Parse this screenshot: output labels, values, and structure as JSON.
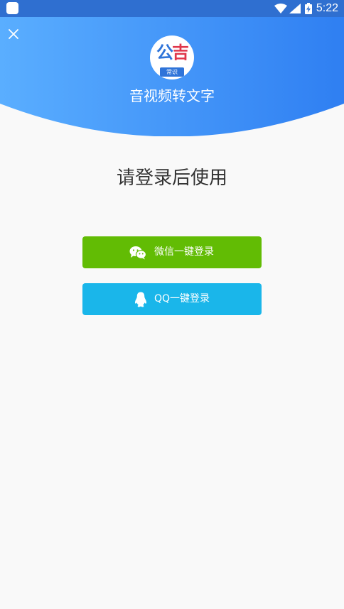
{
  "status_bar": {
    "time": "5:22",
    "icons": [
      "app-notification-icon",
      "wifi-icon",
      "signal-icon",
      "battery-charging-icon"
    ]
  },
  "header": {
    "close_icon": "close-icon",
    "logo_text_blue": "公",
    "logo_text_red": "吉",
    "logo_tag": "常识",
    "app_title": "音视频转文字",
    "gradient_start": "#5aaeff",
    "gradient_end": "#2f7ff2"
  },
  "main": {
    "heading": "请登录后使用",
    "wechat_login": {
      "label": "微信一键登录",
      "icon": "wechat-icon",
      "color": "#62bc04"
    },
    "qq_login": {
      "label": "QQ一键登录",
      "icon": "qq-penguin-icon",
      "color": "#1ab6ea"
    }
  }
}
